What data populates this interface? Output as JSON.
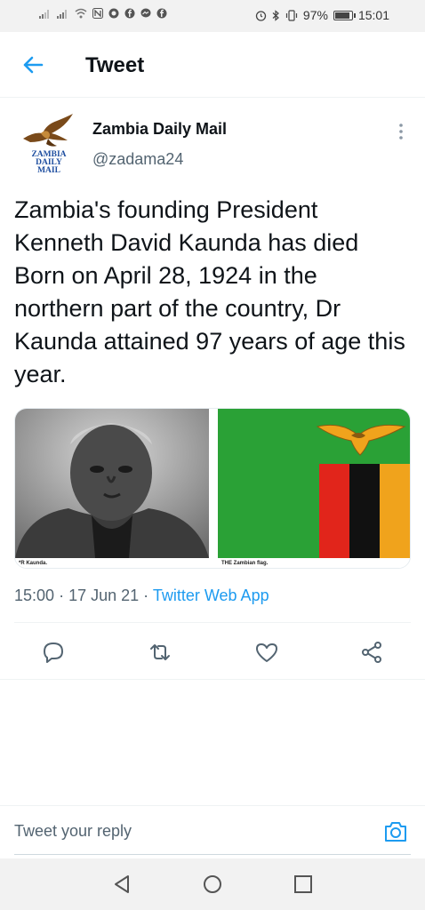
{
  "status_bar": {
    "left_icons": [
      "signal-icon",
      "signal-icon",
      "wifi-icon",
      "nfc-icon",
      "app-icon",
      "facebook-icon",
      "messenger-icon",
      "facebook-icon"
    ],
    "right_icons": [
      "alarm-icon",
      "bluetooth-icon",
      "vibrate-icon"
    ],
    "battery_percent": "97%",
    "battery_level": 0.97,
    "time": "15:01"
  },
  "header": {
    "back_icon": "arrow-left-icon",
    "title": "Tweet"
  },
  "tweet": {
    "avatar_text": [
      "ZAMBIA",
      "DAILY",
      "MAIL"
    ],
    "display_name": "Zambia Daily Mail",
    "handle": "@zadama24",
    "more_icon": "more-vertical-icon",
    "text": "Zambia's founding President Kenneth David Kaunda has died Born on April 28, 1924 in the northern part of the country, Dr Kaunda attained 97 years of age this year.",
    "media": [
      {
        "caption": "*R Kaunda.",
        "kind": "portrait-photo"
      },
      {
        "caption": "THE Zambian flag.",
        "kind": "flag-photo"
      }
    ],
    "time": "15:00",
    "separator": "·",
    "date": "17 Jun 21",
    "source": "Twitter Web App"
  },
  "actions": [
    {
      "name": "reply-icon"
    },
    {
      "name": "retweet-icon"
    },
    {
      "name": "like-icon"
    },
    {
      "name": "share-icon"
    }
  ],
  "reply": {
    "placeholder": "Tweet your reply",
    "camera_icon": "camera-icon"
  },
  "nav_bar": {
    "buttons": [
      "back-triangle-icon",
      "home-circle-icon",
      "recents-square-icon"
    ]
  },
  "colors": {
    "accent": "#1d9bf0",
    "text": "#0f1419",
    "secondary": "#536471",
    "flag_green": "#2aa136",
    "flag_red": "#e1251b",
    "flag_black": "#111111",
    "flag_orange": "#f0a31c"
  }
}
